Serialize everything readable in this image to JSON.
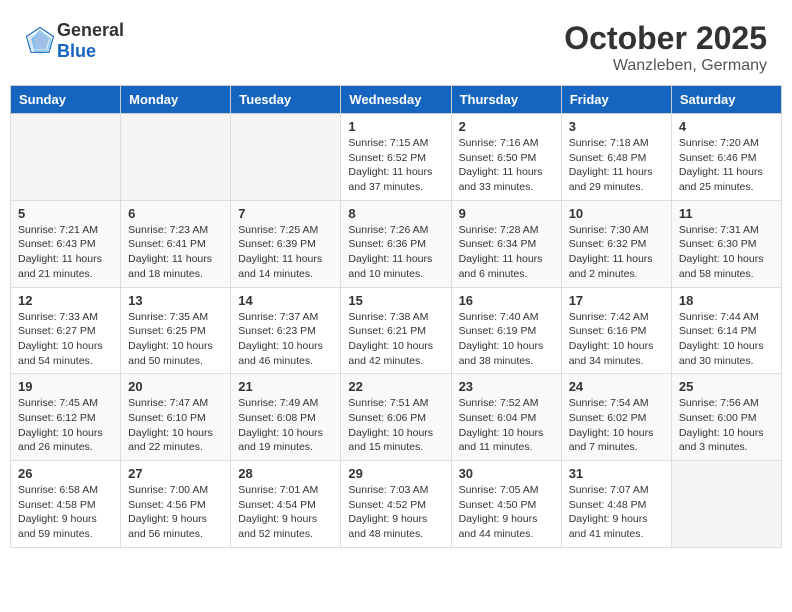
{
  "header": {
    "logo_general": "General",
    "logo_blue": "Blue",
    "month": "October 2025",
    "location": "Wanzleben, Germany"
  },
  "days_of_week": [
    "Sunday",
    "Monday",
    "Tuesday",
    "Wednesday",
    "Thursday",
    "Friday",
    "Saturday"
  ],
  "weeks": [
    [
      {
        "day": "",
        "info": ""
      },
      {
        "day": "",
        "info": ""
      },
      {
        "day": "",
        "info": ""
      },
      {
        "day": "1",
        "info": "Sunrise: 7:15 AM\nSunset: 6:52 PM\nDaylight: 11 hours and 37 minutes."
      },
      {
        "day": "2",
        "info": "Sunrise: 7:16 AM\nSunset: 6:50 PM\nDaylight: 11 hours and 33 minutes."
      },
      {
        "day": "3",
        "info": "Sunrise: 7:18 AM\nSunset: 6:48 PM\nDaylight: 11 hours and 29 minutes."
      },
      {
        "day": "4",
        "info": "Sunrise: 7:20 AM\nSunset: 6:46 PM\nDaylight: 11 hours and 25 minutes."
      }
    ],
    [
      {
        "day": "5",
        "info": "Sunrise: 7:21 AM\nSunset: 6:43 PM\nDaylight: 11 hours and 21 minutes."
      },
      {
        "day": "6",
        "info": "Sunrise: 7:23 AM\nSunset: 6:41 PM\nDaylight: 11 hours and 18 minutes."
      },
      {
        "day": "7",
        "info": "Sunrise: 7:25 AM\nSunset: 6:39 PM\nDaylight: 11 hours and 14 minutes."
      },
      {
        "day": "8",
        "info": "Sunrise: 7:26 AM\nSunset: 6:36 PM\nDaylight: 11 hours and 10 minutes."
      },
      {
        "day": "9",
        "info": "Sunrise: 7:28 AM\nSunset: 6:34 PM\nDaylight: 11 hours and 6 minutes."
      },
      {
        "day": "10",
        "info": "Sunrise: 7:30 AM\nSunset: 6:32 PM\nDaylight: 11 hours and 2 minutes."
      },
      {
        "day": "11",
        "info": "Sunrise: 7:31 AM\nSunset: 6:30 PM\nDaylight: 10 hours and 58 minutes."
      }
    ],
    [
      {
        "day": "12",
        "info": "Sunrise: 7:33 AM\nSunset: 6:27 PM\nDaylight: 10 hours and 54 minutes."
      },
      {
        "day": "13",
        "info": "Sunrise: 7:35 AM\nSunset: 6:25 PM\nDaylight: 10 hours and 50 minutes."
      },
      {
        "day": "14",
        "info": "Sunrise: 7:37 AM\nSunset: 6:23 PM\nDaylight: 10 hours and 46 minutes."
      },
      {
        "day": "15",
        "info": "Sunrise: 7:38 AM\nSunset: 6:21 PM\nDaylight: 10 hours and 42 minutes."
      },
      {
        "day": "16",
        "info": "Sunrise: 7:40 AM\nSunset: 6:19 PM\nDaylight: 10 hours and 38 minutes."
      },
      {
        "day": "17",
        "info": "Sunrise: 7:42 AM\nSunset: 6:16 PM\nDaylight: 10 hours and 34 minutes."
      },
      {
        "day": "18",
        "info": "Sunrise: 7:44 AM\nSunset: 6:14 PM\nDaylight: 10 hours and 30 minutes."
      }
    ],
    [
      {
        "day": "19",
        "info": "Sunrise: 7:45 AM\nSunset: 6:12 PM\nDaylight: 10 hours and 26 minutes."
      },
      {
        "day": "20",
        "info": "Sunrise: 7:47 AM\nSunset: 6:10 PM\nDaylight: 10 hours and 22 minutes."
      },
      {
        "day": "21",
        "info": "Sunrise: 7:49 AM\nSunset: 6:08 PM\nDaylight: 10 hours and 19 minutes."
      },
      {
        "day": "22",
        "info": "Sunrise: 7:51 AM\nSunset: 6:06 PM\nDaylight: 10 hours and 15 minutes."
      },
      {
        "day": "23",
        "info": "Sunrise: 7:52 AM\nSunset: 6:04 PM\nDaylight: 10 hours and 11 minutes."
      },
      {
        "day": "24",
        "info": "Sunrise: 7:54 AM\nSunset: 6:02 PM\nDaylight: 10 hours and 7 minutes."
      },
      {
        "day": "25",
        "info": "Sunrise: 7:56 AM\nSunset: 6:00 PM\nDaylight: 10 hours and 3 minutes."
      }
    ],
    [
      {
        "day": "26",
        "info": "Sunrise: 6:58 AM\nSunset: 4:58 PM\nDaylight: 9 hours and 59 minutes."
      },
      {
        "day": "27",
        "info": "Sunrise: 7:00 AM\nSunset: 4:56 PM\nDaylight: 9 hours and 56 minutes."
      },
      {
        "day": "28",
        "info": "Sunrise: 7:01 AM\nSunset: 4:54 PM\nDaylight: 9 hours and 52 minutes."
      },
      {
        "day": "29",
        "info": "Sunrise: 7:03 AM\nSunset: 4:52 PM\nDaylight: 9 hours and 48 minutes."
      },
      {
        "day": "30",
        "info": "Sunrise: 7:05 AM\nSunset: 4:50 PM\nDaylight: 9 hours and 44 minutes."
      },
      {
        "day": "31",
        "info": "Sunrise: 7:07 AM\nSunset: 4:48 PM\nDaylight: 9 hours and 41 minutes."
      },
      {
        "day": "",
        "info": ""
      }
    ]
  ]
}
